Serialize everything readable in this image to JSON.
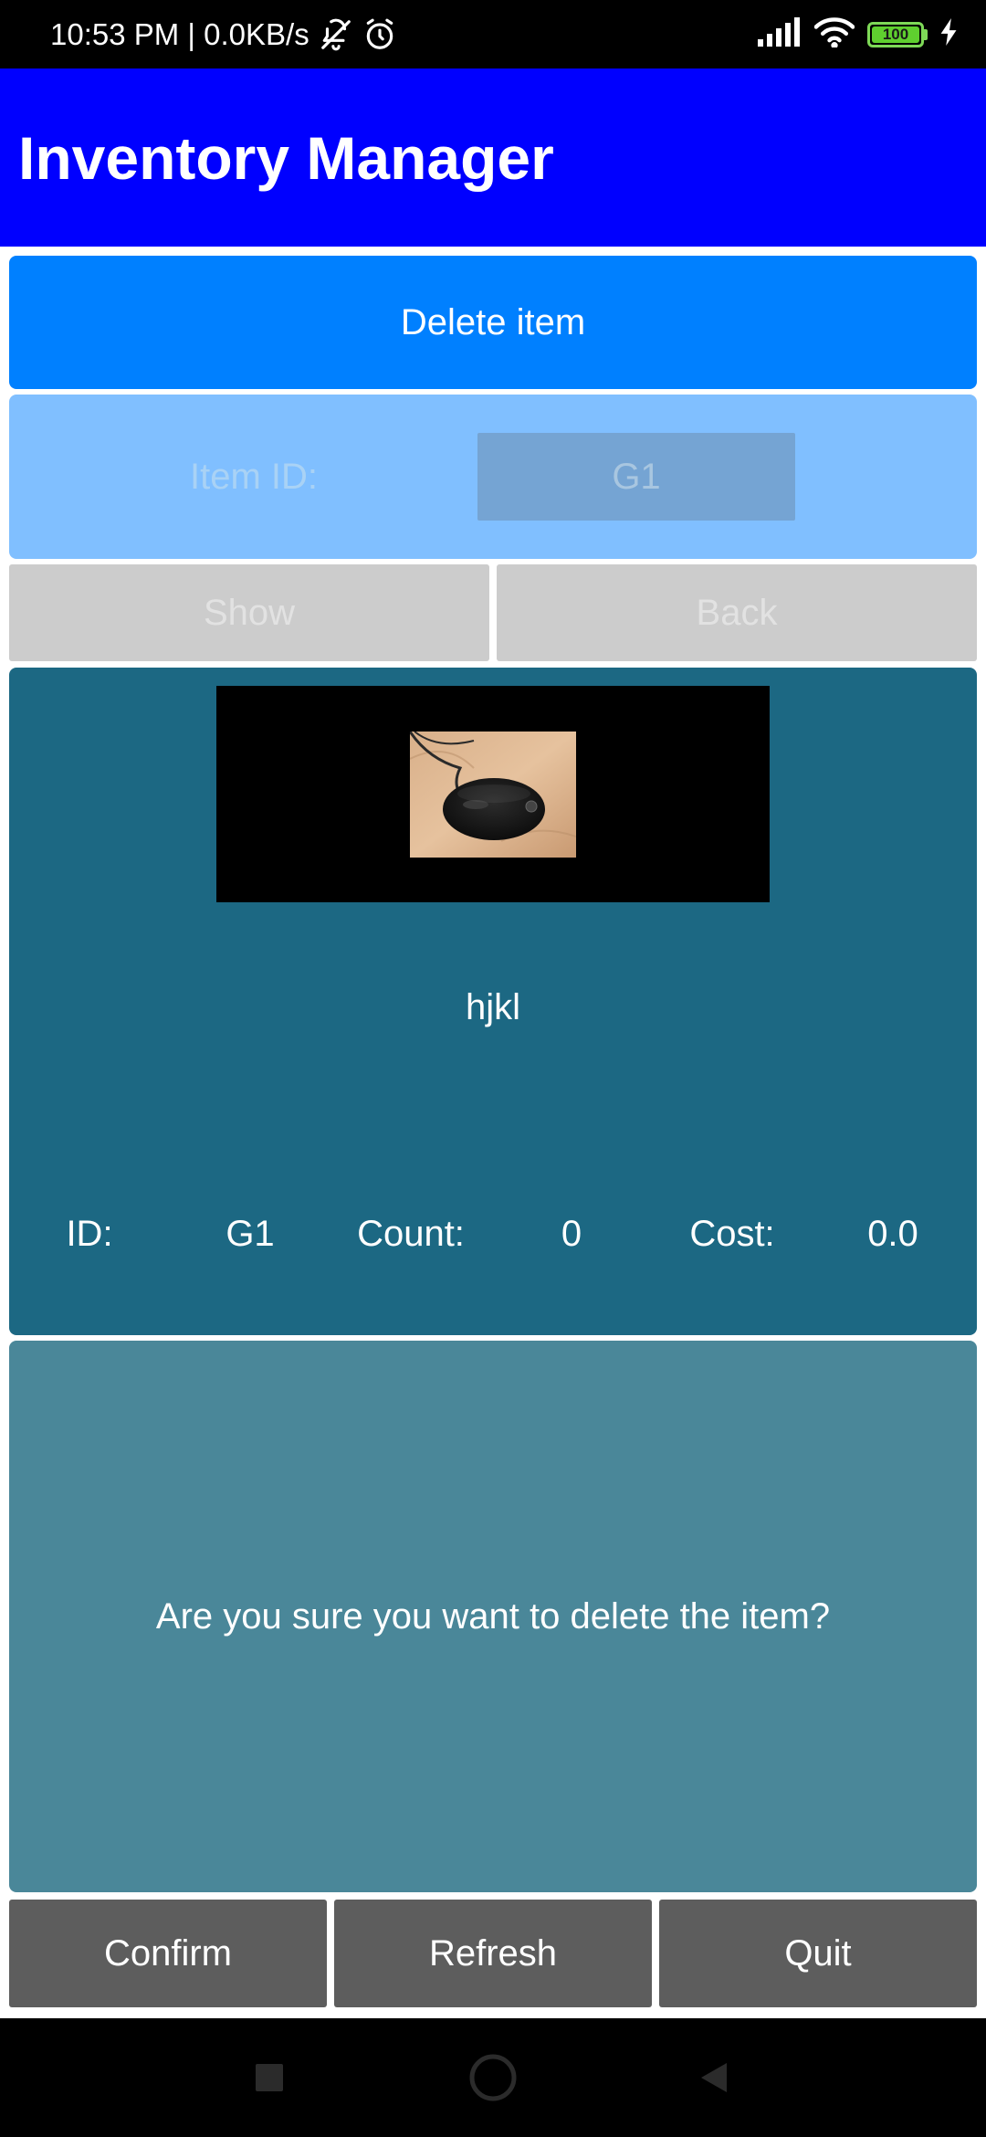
{
  "status_bar": {
    "time_speed": "10:53 PM | 0.0KB/s",
    "battery_level": "100",
    "icons": [
      "bell-off-icon",
      "alarm-icon",
      "signal-icon",
      "wifi-icon",
      "battery-icon",
      "charging-icon"
    ]
  },
  "app_bar": {
    "title": "Inventory Manager",
    "color": "#0000ff"
  },
  "banner": {
    "label": "Delete item",
    "color": "#0080ff"
  },
  "id_form": {
    "label": "Item ID:",
    "value": "G1"
  },
  "top_buttons": {
    "show": "Show",
    "back": "Back"
  },
  "item": {
    "image": "computer-mouse-photo",
    "name": "hjkl",
    "id_label": "ID:",
    "id_value": "G1",
    "count_label": "Count:",
    "count_value": "0",
    "cost_label": "Cost:",
    "cost_value": "0.0"
  },
  "confirm": {
    "message": "Are you sure you want to delete the item?"
  },
  "bottom_buttons": {
    "confirm": "Confirm",
    "refresh": "Refresh",
    "quit": "Quit"
  },
  "nav_bar": {
    "icons": [
      "recents-square-icon",
      "home-circle-icon",
      "back-triangle-icon"
    ]
  }
}
